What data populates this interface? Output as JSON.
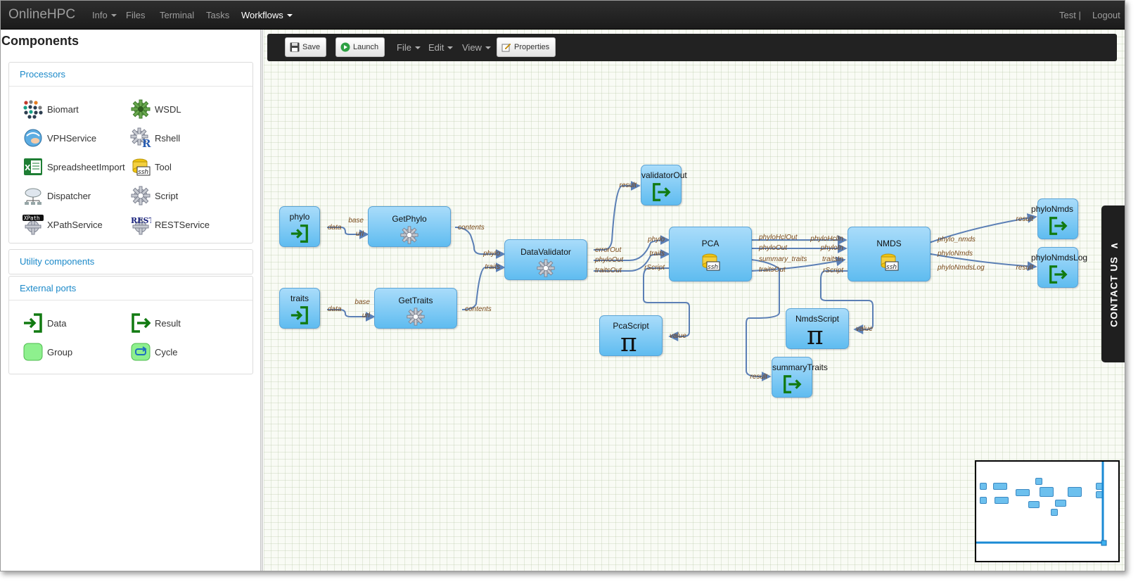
{
  "app": {
    "brand": "OnlineHPC",
    "nav": [
      {
        "label": "Info",
        "dropdown": true
      },
      {
        "label": "Files",
        "dropdown": false
      },
      {
        "label": "Terminal",
        "dropdown": false
      },
      {
        "label": "Tasks",
        "dropdown": false
      },
      {
        "label": "Workflows",
        "dropdown": true,
        "active": true
      }
    ],
    "user": "Test |",
    "logout": "Logout"
  },
  "components": {
    "title": "Components",
    "processors": {
      "label": "Processors",
      "items": [
        {
          "label": "Biomart",
          "icon": "biomart-icon"
        },
        {
          "label": "WSDL",
          "icon": "wsdl-gear-icon"
        },
        {
          "label": "VPHService",
          "icon": "vph-service-icon"
        },
        {
          "label": "Rshell",
          "icon": "rshell-gear-icon"
        },
        {
          "label": "SpreadsheetImport",
          "icon": "spreadsheet-icon"
        },
        {
          "label": "Tool",
          "icon": "ssh-tool-icon"
        },
        {
          "label": "Dispatcher",
          "icon": "dispatcher-icon"
        },
        {
          "label": "Script",
          "icon": "script-gear-icon"
        },
        {
          "label": "XPathService",
          "icon": "xpath-gear-icon"
        },
        {
          "label": "RESTService",
          "icon": "rest-gear-icon"
        }
      ]
    },
    "utility": {
      "label": "Utility components"
    },
    "external": {
      "label": "External ports",
      "items": [
        {
          "label": "Data",
          "icon": "data-input-icon"
        },
        {
          "label": "Result",
          "icon": "result-output-icon"
        },
        {
          "label": "Group",
          "icon": "group-icon"
        },
        {
          "label": "Cycle",
          "icon": "cycle-icon"
        }
      ]
    }
  },
  "toolbar": {
    "save": "Save",
    "launch": "Launch",
    "file": "File",
    "edit": "Edit",
    "view": "View",
    "properties": "Properties"
  },
  "workflow": {
    "nodes": {
      "phylo": "phylo",
      "traits": "traits",
      "getphylo": "GetPhylo",
      "gettraits": "GetTraits",
      "datavalidator": "DataValidator",
      "validatorout": "validatorOut",
      "pca": "PCA",
      "pcascript": "PcaScript",
      "nmds": "NMDS",
      "nmdsscript": "NmdsScript",
      "summarytraits": "summaryTraits",
      "phylonmds": "phyloNmds",
      "phylonmdslog": "phyloNmdsLog"
    },
    "ports": {
      "data": "data",
      "base": "base",
      "url": "url",
      "contents": "contents",
      "phylo": "phylo",
      "traits": "traits",
      "errorOut": "errorOut",
      "phyloOut": "phyloOut",
      "traitsOut": "traitsOut",
      "result": "result",
      "rScript": "rScript",
      "value": "value",
      "phyloHclOut": "phyloHclOut",
      "summary_traits": "summary_traits",
      "phyloHclIn": "phyloHclIn",
      "phyloIn": "phyloIn",
      "traitsIn": "traitsIn",
      "phylo_nmds": "phylo_nmds",
      "phyloNmds": "phyloNmds",
      "phyloNmdsLog": "phyloNmdsLog"
    }
  },
  "contact": "CONTACT US",
  "contact_arrow": "∧",
  "colors": {
    "navbar": "#222222",
    "accent": "#1b89c9",
    "node": "#6cc4f2",
    "wire": "#5b7fb5",
    "port_text": "#7a4a1a",
    "io_green": "#117a11"
  }
}
